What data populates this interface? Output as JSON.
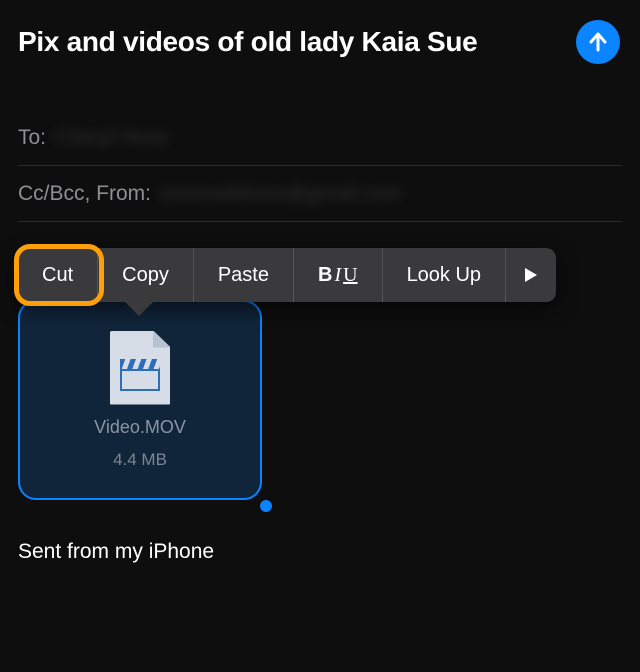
{
  "header": {
    "subject": "Pix and videos of old lady Kaia Sue"
  },
  "fields": {
    "to_label": "To:",
    "to_value": "Cheryl Hess",
    "ccbcc_from_label": "Cc/Bcc, From:",
    "from_value": "someaddress@gmail.com"
  },
  "context_menu": {
    "cut": "Cut",
    "copy": "Copy",
    "paste": "Paste",
    "biu_b": "B",
    "biu_i": "I",
    "biu_u": "U",
    "lookup": "Look Up"
  },
  "attachment": {
    "name": "Video.MOV",
    "size": "4.4 MB"
  },
  "signature": "Sent from my iPhone"
}
